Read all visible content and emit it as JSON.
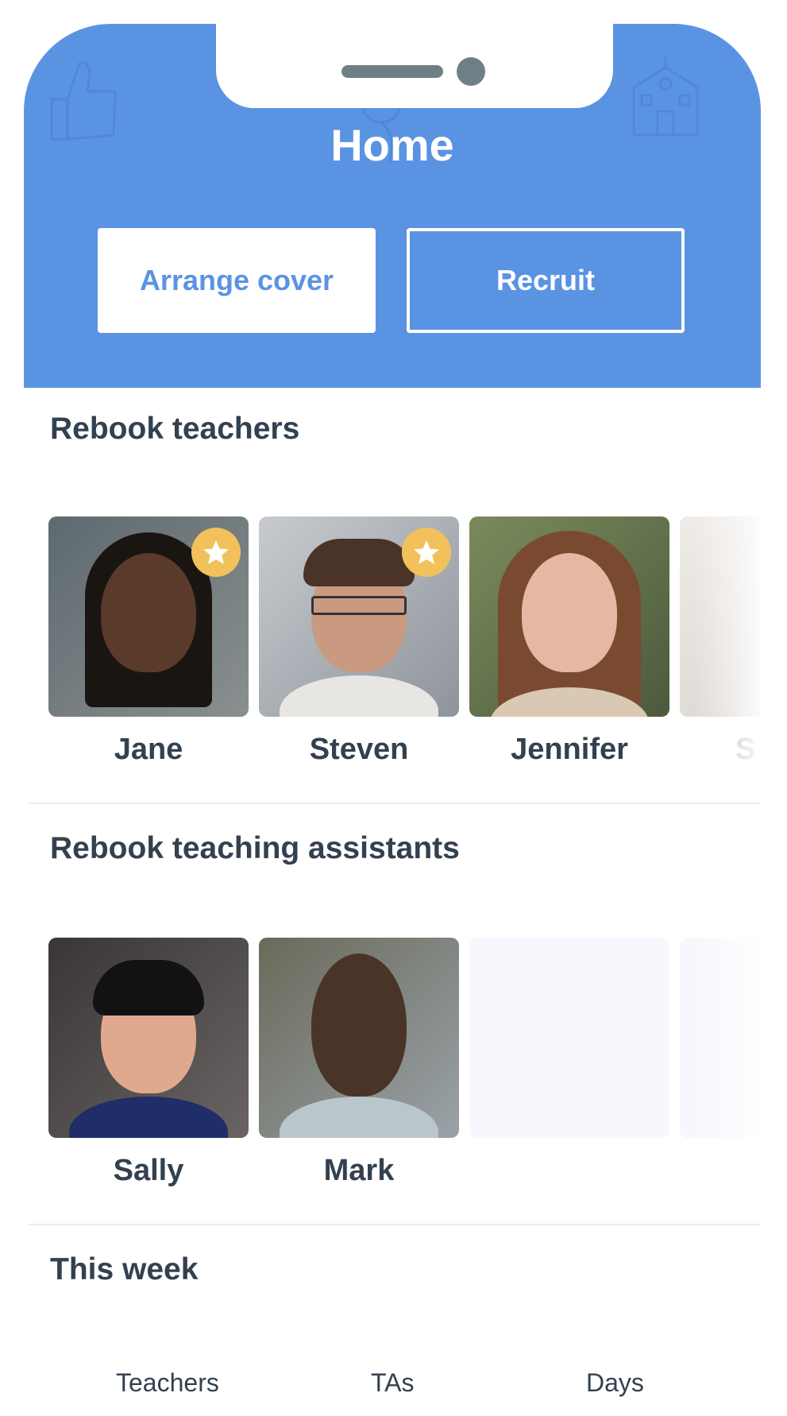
{
  "header": {
    "title": "Home",
    "background_color": "#5b93e3",
    "buttons": {
      "arrange_cover": "Arrange cover",
      "recruit": "Recruit"
    }
  },
  "sections": {
    "teachers": {
      "title": "Rebook teachers",
      "people": [
        {
          "name": "Jane",
          "favorite": true
        },
        {
          "name": "Steven",
          "favorite": true
        },
        {
          "name": "Jennifer",
          "favorite": false
        },
        {
          "name": "S",
          "favorite": false
        }
      ]
    },
    "assistants": {
      "title": "Rebook teaching assistants",
      "people": [
        {
          "name": "Sally",
          "favorite": false
        },
        {
          "name": "Mark",
          "favorite": false
        }
      ]
    },
    "this_week": {
      "title": "This week",
      "stats": [
        "Teachers",
        "TAs",
        "Days"
      ]
    }
  },
  "colors": {
    "accent": "#5b93e3",
    "star_badge": "#f2c15b",
    "text": "#33404f"
  }
}
